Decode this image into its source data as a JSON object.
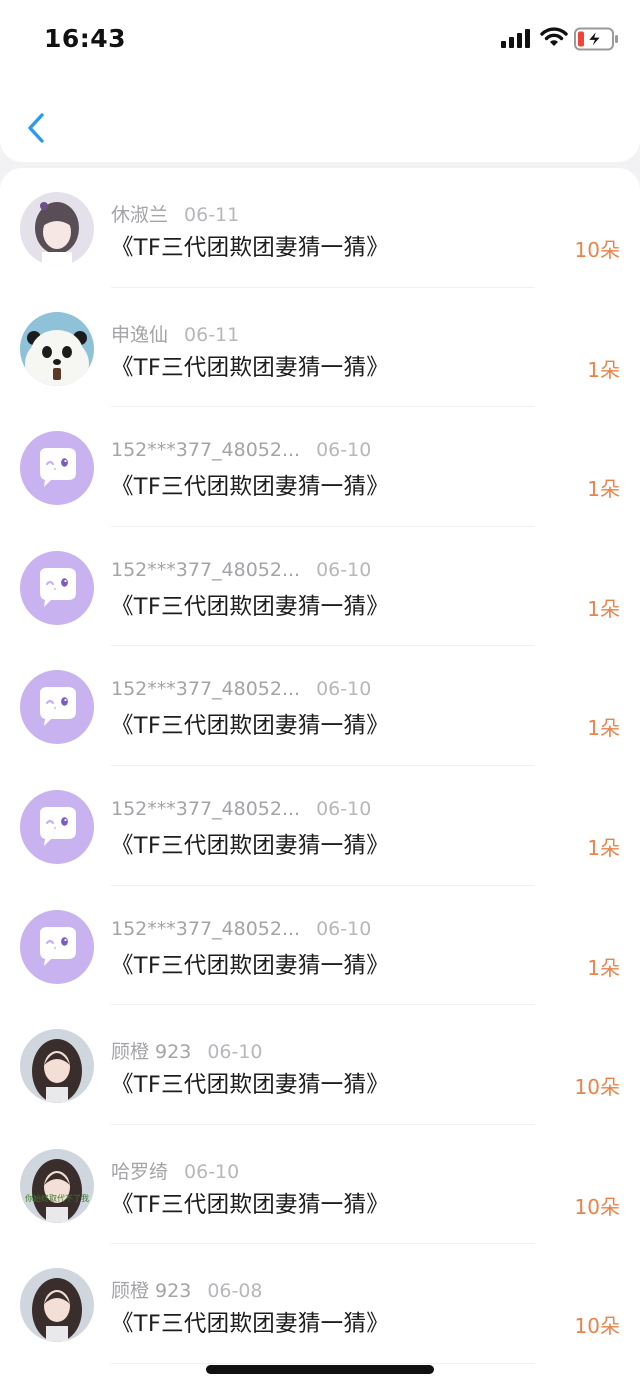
{
  "status_bar": {
    "time": "16:43"
  },
  "colors": {
    "accent": "#2a9bf0",
    "count": "#e8834a",
    "default_avatar": "#c8b2ef"
  },
  "list": [
    {
      "name": "休淑兰",
      "date": "06-11",
      "title": "《TF三代团欺团妻猜一猜》",
      "count": "10朵",
      "avatar": "girl-avatar"
    },
    {
      "name": "申逸仙",
      "date": "06-11",
      "title": "《TF三代团欺团妻猜一猜》",
      "count": "1朵",
      "avatar": "panda-avatar"
    },
    {
      "name": "152***377_48052...",
      "date": "06-10",
      "title": "《TF三代团欺团妻猜一猜》",
      "count": "1朵",
      "avatar": "default-chat-avatar"
    },
    {
      "name": "152***377_48052...",
      "date": "06-10",
      "title": "《TF三代团欺团妻猜一猜》",
      "count": "1朵",
      "avatar": "default-chat-avatar"
    },
    {
      "name": "152***377_48052...",
      "date": "06-10",
      "title": "《TF三代团欺团妻猜一猜》",
      "count": "1朵",
      "avatar": "default-chat-avatar"
    },
    {
      "name": "152***377_48052...",
      "date": "06-10",
      "title": "《TF三代团欺团妻猜一猜》",
      "count": "1朵",
      "avatar": "default-chat-avatar"
    },
    {
      "name": "152***377_48052...",
      "date": "06-10",
      "title": "《TF三代团欺团妻猜一猜》",
      "count": "1朵",
      "avatar": "default-chat-avatar"
    },
    {
      "name": "顾橙 923",
      "date": "06-10",
      "title": "《TF三代团欺团妻猜一猜》",
      "count": "10朵",
      "avatar": "portrait-avatar"
    },
    {
      "name": "哈罗绮",
      "date": "06-10",
      "title": "《TF三代团欺团妻猜一猜》",
      "count": "10朵",
      "avatar": "portrait-avatar",
      "avatar_caption": "你始终取代不了我"
    },
    {
      "name": "顾橙 923",
      "date": "06-08",
      "title": "《TF三代团欺团妻猜一猜》",
      "count": "10朵",
      "avatar": "portrait-avatar"
    }
  ]
}
